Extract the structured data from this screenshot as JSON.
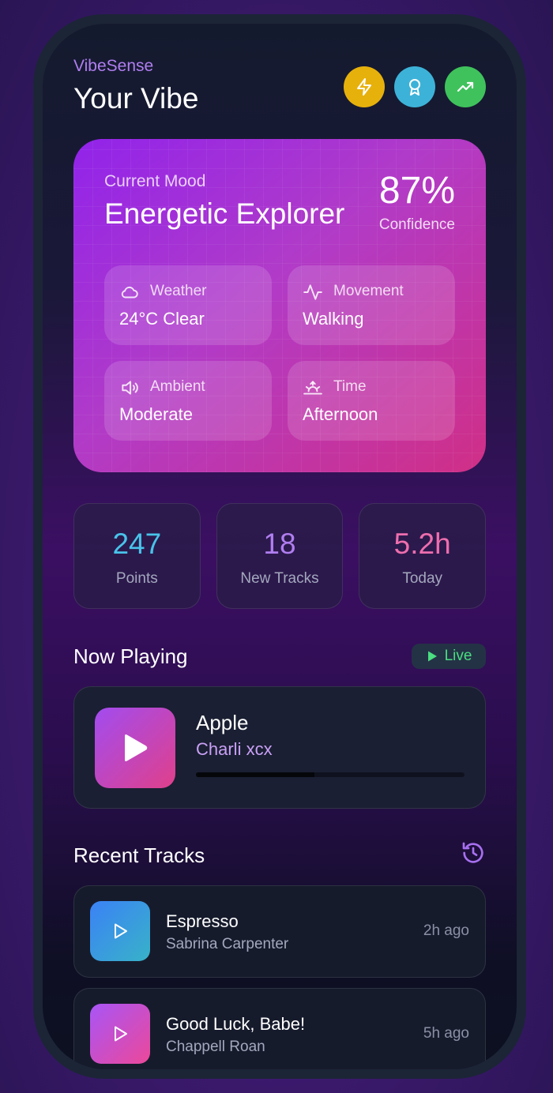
{
  "app": {
    "brand": "VibeSense",
    "title": "Your Vibe"
  },
  "header_buttons": [
    {
      "icon": "lightning-icon",
      "color": "#e7b10c"
    },
    {
      "icon": "award-icon",
      "color": "#3db2d8"
    },
    {
      "icon": "trending-up-icon",
      "color": "#3fc25c"
    }
  ],
  "mood": {
    "label": "Current Mood",
    "name": "Energetic Explorer",
    "confidence_value": "87%",
    "confidence_label": "Confidence",
    "tiles": [
      {
        "icon": "cloud-icon",
        "label": "Weather",
        "value": "24°C Clear"
      },
      {
        "icon": "activity-icon",
        "label": "Movement",
        "value": "Walking"
      },
      {
        "icon": "speaker-icon",
        "label": "Ambient",
        "value": "Moderate"
      },
      {
        "icon": "sunrise-icon",
        "label": "Time",
        "value": "Afternoon"
      }
    ]
  },
  "stats": [
    {
      "value": "247",
      "label": "Points",
      "color": "#48c3ea"
    },
    {
      "value": "18",
      "label": "New Tracks",
      "color": "#b07ef0"
    },
    {
      "value": "5.2h",
      "label": "Today",
      "color": "#ee6eae"
    }
  ],
  "now_playing": {
    "title": "Now Playing",
    "live_label": "Live",
    "song": "Apple",
    "artist": "Charli xcx",
    "progress": 0.44
  },
  "recent": {
    "title": "Recent Tracks",
    "tracks": [
      {
        "song": "Espresso",
        "artist": "Sabrina Carpenter",
        "ago": "2h ago",
        "colors": [
          "#3b82f6",
          "#38b2c8"
        ]
      },
      {
        "song": "Good Luck, Babe!",
        "artist": "Chappell Roan",
        "ago": "5h ago",
        "colors": [
          "#a855f7",
          "#ec4899"
        ]
      }
    ]
  }
}
